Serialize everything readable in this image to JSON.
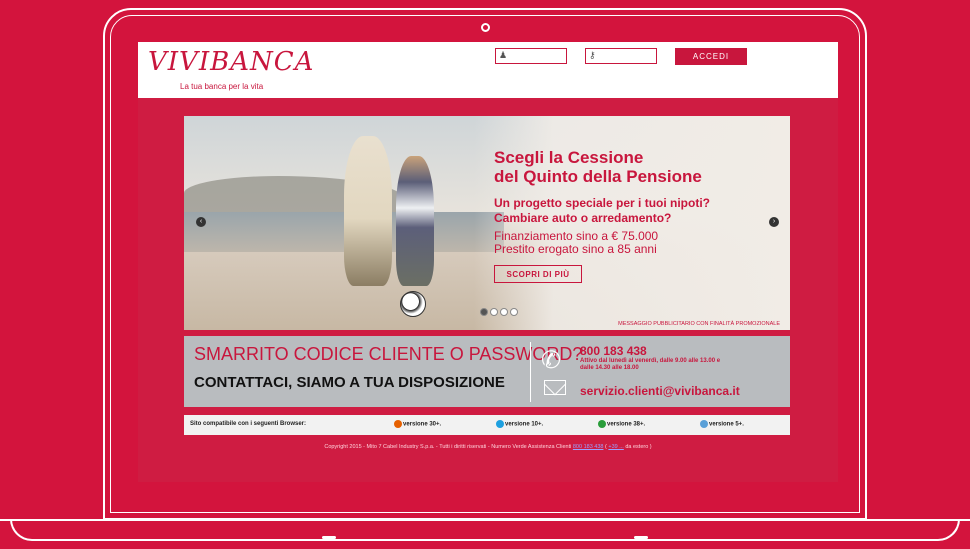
{
  "header": {
    "logo": "VIVIBANCA",
    "tagline": "La tua banca per la vita",
    "login_button": "ACCEDI",
    "username_placeholder": "",
    "password_placeholder": ""
  },
  "banner": {
    "title_line1": "Scegli la Cessione",
    "title_line2": "del Quinto della Pensione",
    "subtitle_line1": "Un progetto speciale per i tuoi nipoti?",
    "subtitle_line2": "Cambiare auto o arredamento?",
    "finance_line1": "Finanziamento sino a € 75.000",
    "finance_line2": "Prestito erogato sino a 85 anni",
    "cta": "SCOPRI DI PIÙ",
    "disclaimer": "MESSAGGIO PUBBLICITARIO CON FINALITÀ PROMOZIONALE",
    "prev_arrow": "‹",
    "next_arrow": "›"
  },
  "contact": {
    "heading": "SMARRITO CODICE CLIENTE O PASSWORD?",
    "subheading": "CONTATTACI, SIAMO A TUA DISPOSIZIONE",
    "phone": "800 183 438",
    "hours_line1": "Attivo dal lunedì al venerdì, dalle 9.00 alle 13.00 e",
    "hours_line2": "dalle 14.30 alle 18.00",
    "email": "servizio.clienti@vivibanca.it"
  },
  "browsers": {
    "label": "Sito compatibile con i seguenti Browser:",
    "items": [
      {
        "version": "versione 30+.",
        "color": "#e66000"
      },
      {
        "version": "versione 10+.",
        "color": "#1ea0e0"
      },
      {
        "version": "versione 38+.",
        "color": "#2a9d3b"
      },
      {
        "version": "versione 5+.",
        "color": "#5aa0d8"
      }
    ]
  },
  "footer": {
    "copyright": "Copyright 2015 - Mito 7 Cabel Industry S.p.a. - Tutti i diritti riservati - Numero Verde Assistenza Clienti",
    "link1": "800 183 438",
    "link2": "+39 ...",
    "suffix": "da estero )"
  },
  "colors": {
    "brand_red": "#c8163d",
    "background": "#d3143d"
  }
}
